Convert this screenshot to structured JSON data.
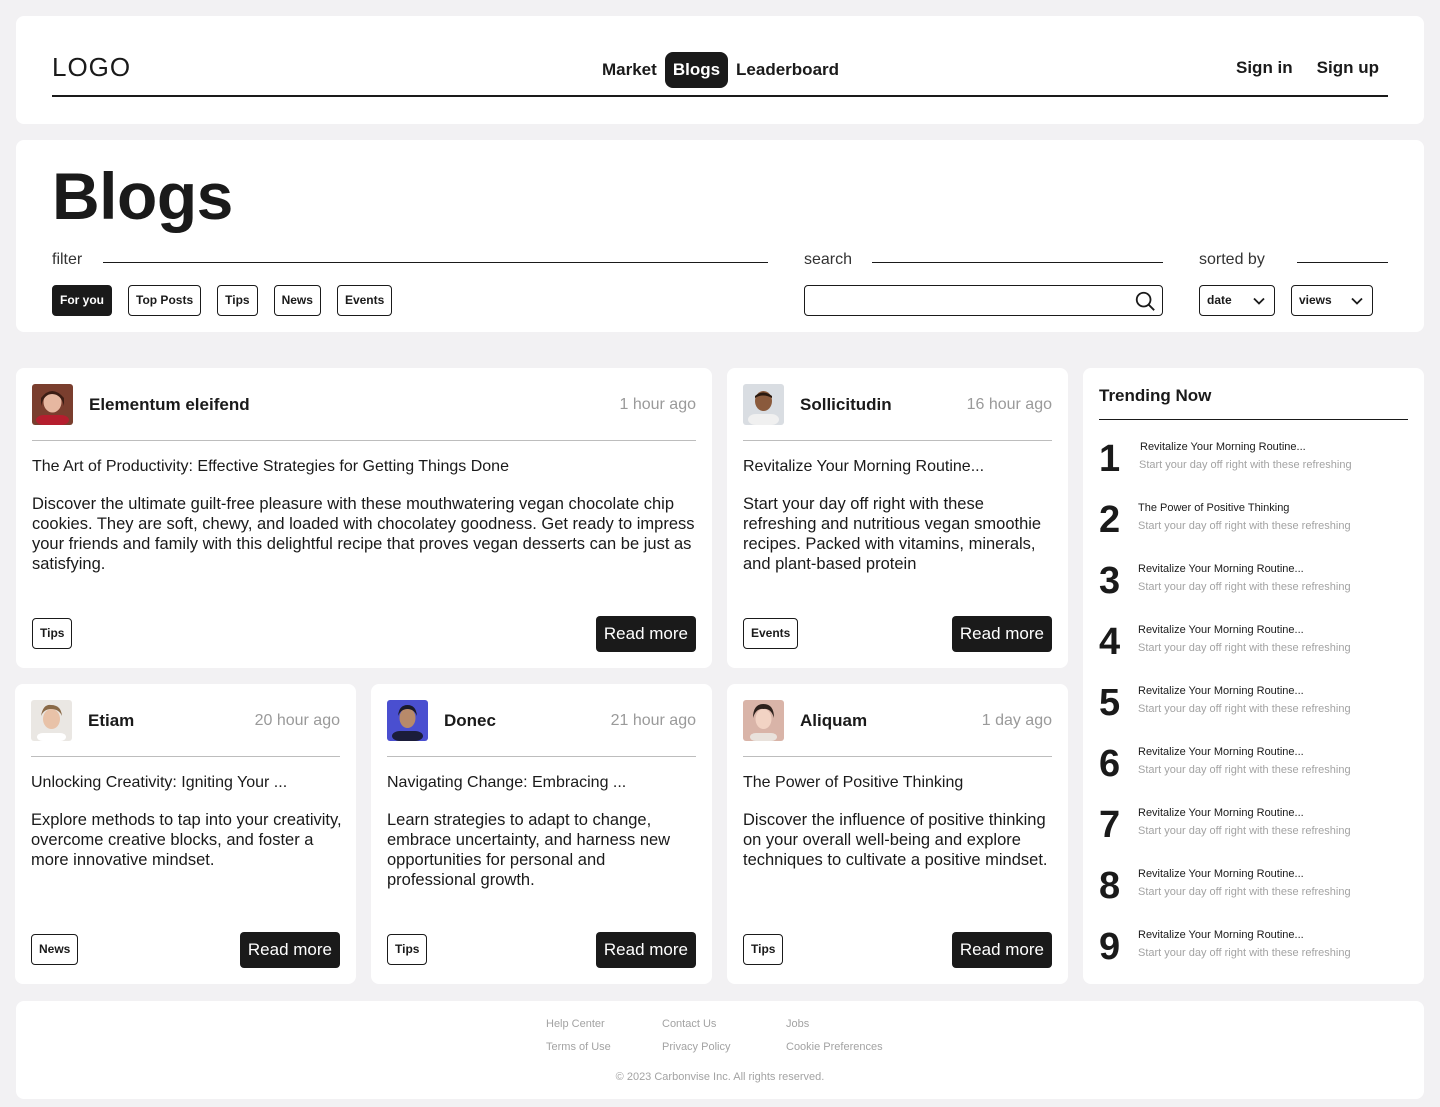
{
  "header": {
    "logo": "LOGO",
    "nav": [
      "Market",
      "Blogs",
      "Leaderboard"
    ],
    "active_nav": "Blogs",
    "sign_in": "Sign in",
    "sign_up": "Sign up"
  },
  "page": {
    "title": "Blogs",
    "filter_label": "filter",
    "search_label": "search",
    "sorted_label": "sorted by",
    "filters": [
      "For you",
      "Top Posts",
      "Tips",
      "News",
      "Events"
    ],
    "active_filter": "For you",
    "search_value": "",
    "sort_primary": "date",
    "sort_secondary": "views"
  },
  "posts": [
    {
      "author": "Elementum eleifend",
      "time": "1 hour ago",
      "title": "The Art of Productivity: Effective Strategies for Getting Things Done",
      "description": "Discover the ultimate guilt-free pleasure with these mouthwatering vegan chocolate chip cookies. They are soft, chewy, and loaded with chocolatey goodness. Get ready to impress your friends and family with this delightful recipe that proves vegan desserts can be just as satisfying.",
      "tag": "Tips",
      "cta": "Read more"
    },
    {
      "author": "Sollicitudin",
      "time": "16 hour ago",
      "title": "Revitalize Your Morning Routine...",
      "description": "Start your day off right with these refreshing and nutritious vegan smoothie recipes. Packed with vitamins, minerals, and plant-based protein",
      "tag": "Events",
      "cta": "Read more"
    },
    {
      "author": "Etiam",
      "time": "20 hour ago",
      "title": "Unlocking Creativity: Igniting Your ...",
      "description": "Explore methods to tap into your creativity, overcome creative blocks, and foster a more innovative mindset.",
      "tag": "News",
      "cta": "Read more"
    },
    {
      "author": "Donec",
      "time": "21 hour ago",
      "title": "Navigating Change: Embracing ...",
      "description": "Learn strategies to adapt to change, embrace uncertainty, and harness new opportunities for personal and professional growth.",
      "tag": "Tips",
      "cta": "Read more"
    },
    {
      "author": "Aliquam",
      "time": "1 day ago",
      "title": "The Power of Positive Thinking",
      "description": "Discover the influence of positive thinking on your overall well-being and explore techniques to cultivate a positive mindset.",
      "tag": "Tips",
      "cta": "Read more"
    }
  ],
  "trending": {
    "heading": "Trending Now",
    "items": [
      {
        "rank": "1",
        "title": "Revitalize Your Morning Routine...",
        "subtitle": "Start your day off right with these refreshing"
      },
      {
        "rank": "2",
        "title": "The Power of Positive Thinking",
        "subtitle": "Start your day off right with these refreshing"
      },
      {
        "rank": "3",
        "title": "Revitalize Your Morning Routine...",
        "subtitle": "Start your day off right with these refreshing"
      },
      {
        "rank": "4",
        "title": "Revitalize Your Morning Routine...",
        "subtitle": "Start your day off right with these refreshing"
      },
      {
        "rank": "5",
        "title": "Revitalize Your Morning Routine...",
        "subtitle": "Start your day off right with these refreshing"
      },
      {
        "rank": "6",
        "title": "Revitalize Your Morning Routine...",
        "subtitle": "Start your day off right with these refreshing"
      },
      {
        "rank": "7",
        "title": "Revitalize Your Morning Routine...",
        "subtitle": "Start your day off right with these refreshing"
      },
      {
        "rank": "8",
        "title": "Revitalize Your Morning Routine...",
        "subtitle": "Start your day off right with these refreshing"
      },
      {
        "rank": "9",
        "title": "Revitalize Your Morning Routine...",
        "subtitle": "Start your day off right with these refreshing"
      }
    ]
  },
  "footer": {
    "links": [
      "Help Center",
      "Terms of Use",
      "Contact Us",
      "Privacy Policy",
      "Jobs",
      "Cookie Preferences"
    ],
    "copyright": "© 2023  Carbonvise Inc. All rights reserved."
  },
  "colors": {
    "primary": "#1a1a1a",
    "background": "#f2f1f3",
    "muted": "#9a9a9a"
  }
}
